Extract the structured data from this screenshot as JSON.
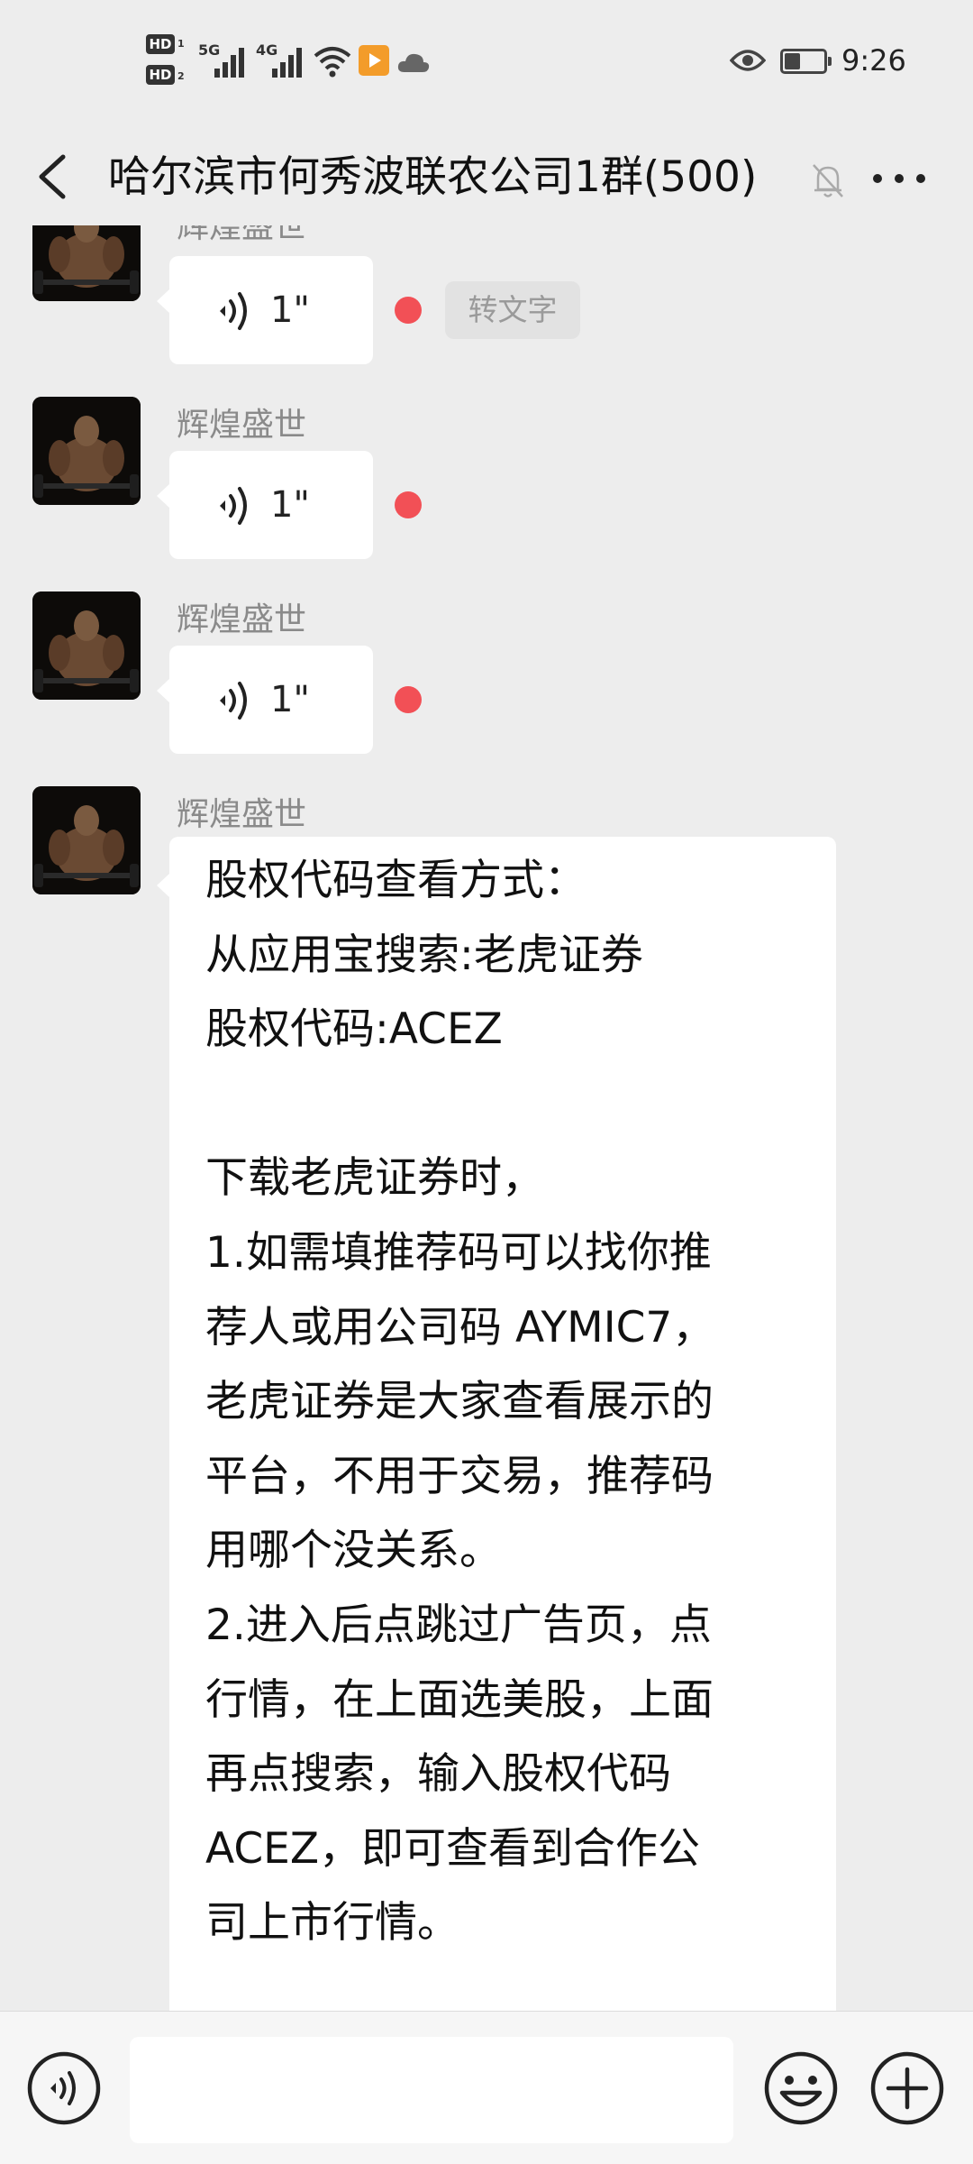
{
  "status_bar": {
    "time": "9:26",
    "hd_badges": [
      "HD",
      "HD"
    ],
    "hd_sub": [
      "1",
      "2"
    ],
    "networks": [
      "5G",
      "4G"
    ],
    "battery_level": 0.4,
    "icons": [
      "wifi-icon",
      "video-app-icon",
      "cloud-icon",
      "eye-icon",
      "battery-icon"
    ]
  },
  "header": {
    "title": "哈尔滨市何秀波联农公司1群(500)",
    "back_icon": "chevron-left-icon",
    "muted_icon": "bell-off-icon",
    "more_icon": "more-dots-icon"
  },
  "messages": [
    {
      "sender": "辉煌盛世",
      "type": "voice",
      "duration": "1\"",
      "unread": true,
      "action": "转文字"
    },
    {
      "sender": "辉煌盛世",
      "type": "voice",
      "duration": "1\"",
      "unread": true
    },
    {
      "sender": "辉煌盛世",
      "type": "voice",
      "duration": "1\"",
      "unread": true
    },
    {
      "sender": "辉煌盛世",
      "type": "text",
      "lines": [
        "股权代码查看方式：",
        "从应用宝搜索:老虎证券",
        "股权代码:ACEZ",
        "",
        "下载老虎证券时，",
        "1.如需填推荐码可以找你推",
        "荐人或用公司码 AYMIC7，",
        "老虎证券是大家查看展示的",
        "平台，不用于交易，推荐码",
        "用哪个没关系。",
        "2.进入后点跳过广告页，点",
        "行情，在上面选美股，上面",
        "再点搜索，输入股权代码",
        "ACEZ，即可查看到合作公",
        "司上市行情。"
      ]
    }
  ],
  "input_bar": {
    "voice_icon": "voice-input-icon",
    "input_value": "",
    "emoji_icon": "emoji-icon",
    "add_icon": "plus-circle-icon"
  },
  "colors": {
    "background": "#ededed",
    "bubble": "#ffffff",
    "unread_dot": "#f25056",
    "sender_name": "#8a8a8a"
  }
}
